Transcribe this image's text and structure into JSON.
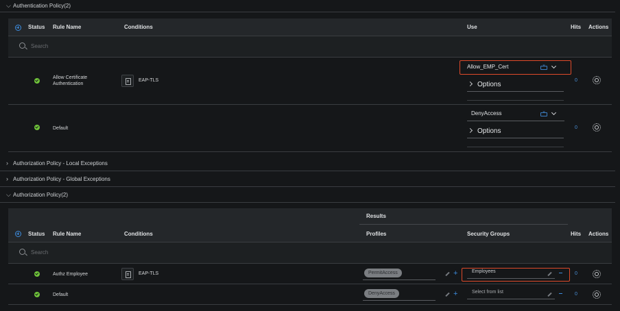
{
  "auth_policy": {
    "title": "Authentication Policy(2)",
    "columns": {
      "status": "Status",
      "rule_name": "Rule Name",
      "conditions": "Conditions",
      "use": "Use",
      "hits": "Hits",
      "actions": "Actions"
    },
    "search_placeholder": "Search",
    "rows": [
      {
        "name": "Allow Certificate Authentication",
        "condition": "EAP-TLS",
        "use": "Allow_EMP_Cert",
        "options_label": "Options",
        "hits": "0",
        "status": "enabled"
      },
      {
        "name": "Default",
        "condition": "",
        "use": "DenyAccess",
        "options_label": "Options",
        "hits": "0",
        "status": "enabled"
      }
    ]
  },
  "collapsed_sections": [
    {
      "title": "Authorization Policy - Local Exceptions"
    },
    {
      "title": "Authorization Policy - Global Exceptions"
    }
  ],
  "authz_policy": {
    "title": "Authorization Policy(2)",
    "results_label": "Results",
    "columns": {
      "status": "Status",
      "rule_name": "Rule Name",
      "conditions": "Conditions",
      "profiles": "Profiles",
      "security_groups": "Security Groups",
      "hits": "Hits",
      "actions": "Actions"
    },
    "search_placeholder": "Search",
    "rows": [
      {
        "name": "Authz Employee",
        "condition": "EAP-TLS",
        "profile": "PermitAccess",
        "security_group": "Employees",
        "hits": "0",
        "status": "enabled"
      },
      {
        "name": "Default",
        "condition": "",
        "profile": "DenyAccess",
        "security_group": "Select from list",
        "hits": "0",
        "status": "enabled"
      }
    ]
  },
  "colors": {
    "background": "#151719",
    "header_bg": "#24272a",
    "status_green": "#6fc33a",
    "accent_blue": "#3d8de0",
    "highlight_red": "#e04a2a"
  }
}
